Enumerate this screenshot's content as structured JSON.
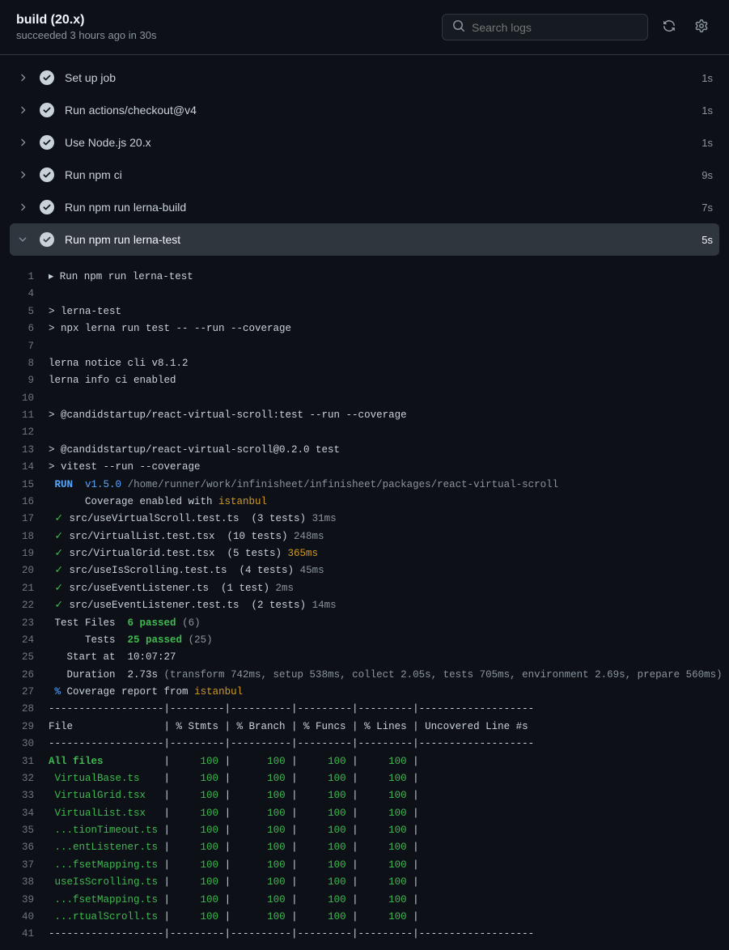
{
  "header": {
    "title": "build (20.x)",
    "subtitle": "succeeded 3 hours ago in 30s",
    "search_placeholder": "Search logs"
  },
  "steps": [
    {
      "name": "Set up job",
      "time": "1s",
      "expanded": false
    },
    {
      "name": "Run actions/checkout@v4",
      "time": "1s",
      "expanded": false
    },
    {
      "name": "Use Node.js 20.x",
      "time": "1s",
      "expanded": false
    },
    {
      "name": "Run npm ci",
      "time": "9s",
      "expanded": false
    },
    {
      "name": "Run npm run lerna-build",
      "time": "7s",
      "expanded": false
    },
    {
      "name": "Run npm run lerna-test",
      "time": "5s",
      "expanded": true
    }
  ],
  "log": [
    {
      "n": 1,
      "segs": [
        {
          "t": "▸ Run npm run lerna-test"
        }
      ]
    },
    {
      "n": 4,
      "segs": []
    },
    {
      "n": 5,
      "segs": [
        {
          "t": "> lerna-test"
        }
      ]
    },
    {
      "n": 6,
      "segs": [
        {
          "t": "> npx lerna run test -- --run --coverage"
        }
      ]
    },
    {
      "n": 7,
      "segs": []
    },
    {
      "n": 8,
      "segs": [
        {
          "t": "lerna notice cli v8.1.2"
        }
      ]
    },
    {
      "n": 9,
      "segs": [
        {
          "t": "lerna info ci enabled"
        }
      ]
    },
    {
      "n": 10,
      "segs": []
    },
    {
      "n": 11,
      "segs": [
        {
          "t": "> @candidstartup/react-virtual-scroll:test --run --coverage"
        }
      ]
    },
    {
      "n": 12,
      "segs": []
    },
    {
      "n": 13,
      "segs": [
        {
          "t": "> @candidstartup/react-virtual-scroll@0.2.0 test"
        }
      ]
    },
    {
      "n": 14,
      "segs": [
        {
          "t": "> vitest --run --coverage"
        }
      ]
    },
    {
      "n": 15,
      "segs": [
        {
          "t": " ",
          "c": ""
        },
        {
          "t": "RUN",
          "c": "c-blue c-bold"
        },
        {
          "t": "  "
        },
        {
          "t": "v1.5.0",
          "c": "c-blue"
        },
        {
          "t": " "
        },
        {
          "t": "/home/runner/work/infinisheet/infinisheet/packages/react-virtual-scroll",
          "c": "c-gray"
        }
      ]
    },
    {
      "n": 16,
      "segs": [
        {
          "t": "      Coverage enabled with "
        },
        {
          "t": "istanbul",
          "c": "c-yellow"
        }
      ]
    },
    {
      "n": 17,
      "segs": [
        {
          "t": " "
        },
        {
          "t": "✓",
          "c": "c-green"
        },
        {
          "t": " src/useVirtualScroll.test.ts  (3 tests) "
        },
        {
          "t": "31ms",
          "c": "c-gray"
        }
      ]
    },
    {
      "n": 18,
      "segs": [
        {
          "t": " "
        },
        {
          "t": "✓",
          "c": "c-green"
        },
        {
          "t": " src/VirtualList.test.tsx  (10 tests) "
        },
        {
          "t": "248ms",
          "c": "c-gray"
        }
      ]
    },
    {
      "n": 19,
      "segs": [
        {
          "t": " "
        },
        {
          "t": "✓",
          "c": "c-green"
        },
        {
          "t": " src/VirtualGrid.test.tsx  (5 tests) "
        },
        {
          "t": "365ms",
          "c": "c-yellow"
        }
      ]
    },
    {
      "n": 20,
      "segs": [
        {
          "t": " "
        },
        {
          "t": "✓",
          "c": "c-green"
        },
        {
          "t": " src/useIsScrolling.test.ts  (4 tests) "
        },
        {
          "t": "45ms",
          "c": "c-gray"
        }
      ]
    },
    {
      "n": 21,
      "segs": [
        {
          "t": " "
        },
        {
          "t": "✓",
          "c": "c-green"
        },
        {
          "t": " src/useEventListener.ts  (1 test) "
        },
        {
          "t": "2ms",
          "c": "c-gray"
        }
      ]
    },
    {
      "n": 22,
      "segs": [
        {
          "t": " "
        },
        {
          "t": "✓",
          "c": "c-green"
        },
        {
          "t": " src/useEventListener.test.ts  (2 tests) "
        },
        {
          "t": "14ms",
          "c": "c-gray"
        }
      ]
    },
    {
      "n": 23,
      "segs": [
        {
          "t": " Test Files  "
        },
        {
          "t": "6 passed",
          "c": "c-green c-bold"
        },
        {
          "t": " "
        },
        {
          "t": "(6)",
          "c": "c-gray"
        }
      ]
    },
    {
      "n": 24,
      "segs": [
        {
          "t": "      Tests  "
        },
        {
          "t": "25 passed",
          "c": "c-green c-bold"
        },
        {
          "t": " "
        },
        {
          "t": "(25)",
          "c": "c-gray"
        }
      ]
    },
    {
      "n": 25,
      "segs": [
        {
          "t": "   Start at  10:07:27"
        }
      ]
    },
    {
      "n": 26,
      "segs": [
        {
          "t": "   Duration  2.73s "
        },
        {
          "t": "(transform 742ms, setup 538ms, collect 2.05s, tests 705ms, environment 2.69s, prepare 560ms)",
          "c": "c-gray"
        }
      ]
    },
    {
      "n": 27,
      "segs": [
        {
          "t": " "
        },
        {
          "t": "%",
          "c": "c-blue"
        },
        {
          "t": " Coverage report from "
        },
        {
          "t": "istanbul",
          "c": "c-yellow"
        }
      ]
    },
    {
      "n": 28,
      "segs": [
        {
          "t": "-------------------|---------|----------|---------|---------|-------------------"
        }
      ]
    },
    {
      "n": 29,
      "segs": [
        {
          "t": "File               | % Stmts | % Branch | % Funcs | % Lines | Uncovered Line #s "
        }
      ]
    },
    {
      "n": 30,
      "segs": [
        {
          "t": "-------------------|---------|----------|---------|---------|-------------------"
        }
      ]
    },
    {
      "n": 31,
      "segs": [
        {
          "t": "All files         ",
          "c": "c-green c-bold"
        },
        {
          "t": " |     "
        },
        {
          "t": "100",
          "c": "c-green"
        },
        {
          "t": " |      "
        },
        {
          "t": "100",
          "c": "c-green"
        },
        {
          "t": " |     "
        },
        {
          "t": "100",
          "c": "c-green"
        },
        {
          "t": " |     "
        },
        {
          "t": "100",
          "c": "c-green"
        },
        {
          "t": " |                   "
        }
      ]
    },
    {
      "n": 32,
      "segs": [
        {
          "t": " VirtualBase.ts   ",
          "c": "c-green"
        },
        {
          "t": " |     "
        },
        {
          "t": "100",
          "c": "c-green"
        },
        {
          "t": " |      "
        },
        {
          "t": "100",
          "c": "c-green"
        },
        {
          "t": " |     "
        },
        {
          "t": "100",
          "c": "c-green"
        },
        {
          "t": " |     "
        },
        {
          "t": "100",
          "c": "c-green"
        },
        {
          "t": " |                   "
        }
      ]
    },
    {
      "n": 33,
      "segs": [
        {
          "t": " VirtualGrid.tsx  ",
          "c": "c-green"
        },
        {
          "t": " |     "
        },
        {
          "t": "100",
          "c": "c-green"
        },
        {
          "t": " |      "
        },
        {
          "t": "100",
          "c": "c-green"
        },
        {
          "t": " |     "
        },
        {
          "t": "100",
          "c": "c-green"
        },
        {
          "t": " |     "
        },
        {
          "t": "100",
          "c": "c-green"
        },
        {
          "t": " |                   "
        }
      ]
    },
    {
      "n": 34,
      "segs": [
        {
          "t": " VirtualList.tsx  ",
          "c": "c-green"
        },
        {
          "t": " |     "
        },
        {
          "t": "100",
          "c": "c-green"
        },
        {
          "t": " |      "
        },
        {
          "t": "100",
          "c": "c-green"
        },
        {
          "t": " |     "
        },
        {
          "t": "100",
          "c": "c-green"
        },
        {
          "t": " |     "
        },
        {
          "t": "100",
          "c": "c-green"
        },
        {
          "t": " |                   "
        }
      ]
    },
    {
      "n": 35,
      "segs": [
        {
          "t": " ...tionTimeout.ts",
          "c": "c-green"
        },
        {
          "t": " |     "
        },
        {
          "t": "100",
          "c": "c-green"
        },
        {
          "t": " |      "
        },
        {
          "t": "100",
          "c": "c-green"
        },
        {
          "t": " |     "
        },
        {
          "t": "100",
          "c": "c-green"
        },
        {
          "t": " |     "
        },
        {
          "t": "100",
          "c": "c-green"
        },
        {
          "t": " |                   "
        }
      ]
    },
    {
      "n": 36,
      "segs": [
        {
          "t": " ...entListener.ts",
          "c": "c-green"
        },
        {
          "t": " |     "
        },
        {
          "t": "100",
          "c": "c-green"
        },
        {
          "t": " |      "
        },
        {
          "t": "100",
          "c": "c-green"
        },
        {
          "t": " |     "
        },
        {
          "t": "100",
          "c": "c-green"
        },
        {
          "t": " |     "
        },
        {
          "t": "100",
          "c": "c-green"
        },
        {
          "t": " |                   "
        }
      ]
    },
    {
      "n": 37,
      "segs": [
        {
          "t": " ...fsetMapping.ts",
          "c": "c-green"
        },
        {
          "t": " |     "
        },
        {
          "t": "100",
          "c": "c-green"
        },
        {
          "t": " |      "
        },
        {
          "t": "100",
          "c": "c-green"
        },
        {
          "t": " |     "
        },
        {
          "t": "100",
          "c": "c-green"
        },
        {
          "t": " |     "
        },
        {
          "t": "100",
          "c": "c-green"
        },
        {
          "t": " |                   "
        }
      ]
    },
    {
      "n": 38,
      "segs": [
        {
          "t": " useIsScrolling.ts",
          "c": "c-green"
        },
        {
          "t": " |     "
        },
        {
          "t": "100",
          "c": "c-green"
        },
        {
          "t": " |      "
        },
        {
          "t": "100",
          "c": "c-green"
        },
        {
          "t": " |     "
        },
        {
          "t": "100",
          "c": "c-green"
        },
        {
          "t": " |     "
        },
        {
          "t": "100",
          "c": "c-green"
        },
        {
          "t": " |                   "
        }
      ]
    },
    {
      "n": 39,
      "segs": [
        {
          "t": " ...fsetMapping.ts",
          "c": "c-green"
        },
        {
          "t": " |     "
        },
        {
          "t": "100",
          "c": "c-green"
        },
        {
          "t": " |      "
        },
        {
          "t": "100",
          "c": "c-green"
        },
        {
          "t": " |     "
        },
        {
          "t": "100",
          "c": "c-green"
        },
        {
          "t": " |     "
        },
        {
          "t": "100",
          "c": "c-green"
        },
        {
          "t": " |                   "
        }
      ]
    },
    {
      "n": 40,
      "segs": [
        {
          "t": " ...rtualScroll.ts",
          "c": "c-green"
        },
        {
          "t": " |     "
        },
        {
          "t": "100",
          "c": "c-green"
        },
        {
          "t": " |      "
        },
        {
          "t": "100",
          "c": "c-green"
        },
        {
          "t": " |     "
        },
        {
          "t": "100",
          "c": "c-green"
        },
        {
          "t": " |     "
        },
        {
          "t": "100",
          "c": "c-green"
        },
        {
          "t": " |                   "
        }
      ]
    },
    {
      "n": 41,
      "segs": [
        {
          "t": "-------------------|---------|----------|---------|---------|-------------------"
        }
      ]
    }
  ]
}
